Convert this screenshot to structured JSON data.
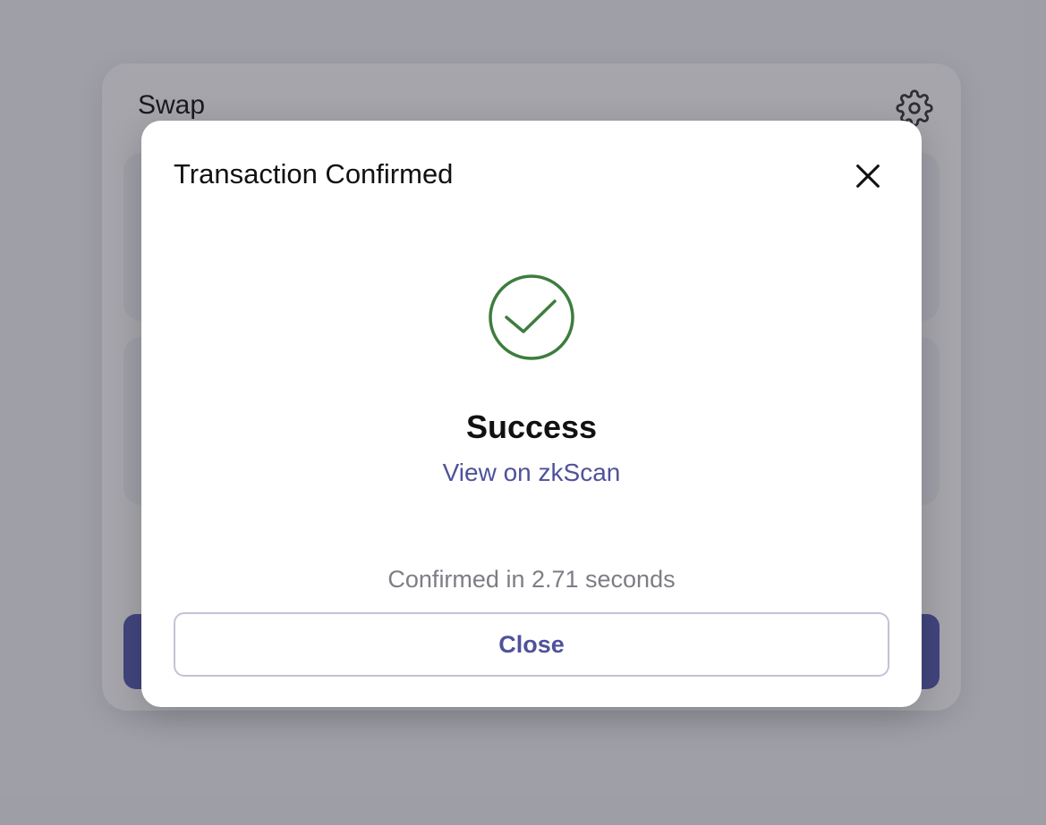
{
  "swap": {
    "title": "Swap"
  },
  "modal": {
    "title": "Transaction Confirmed",
    "status": "Success",
    "explorer_link": "View on zkScan",
    "confirmation_text": "Confirmed in 2.71 seconds",
    "close_label": "Close"
  },
  "icons": {
    "settings": "gear-icon",
    "close": "close-icon",
    "success": "check-circle-icon"
  },
  "colors": {
    "success": "#3d7d3e",
    "accent": "#4f529a",
    "primary_button": "#545ab0"
  }
}
